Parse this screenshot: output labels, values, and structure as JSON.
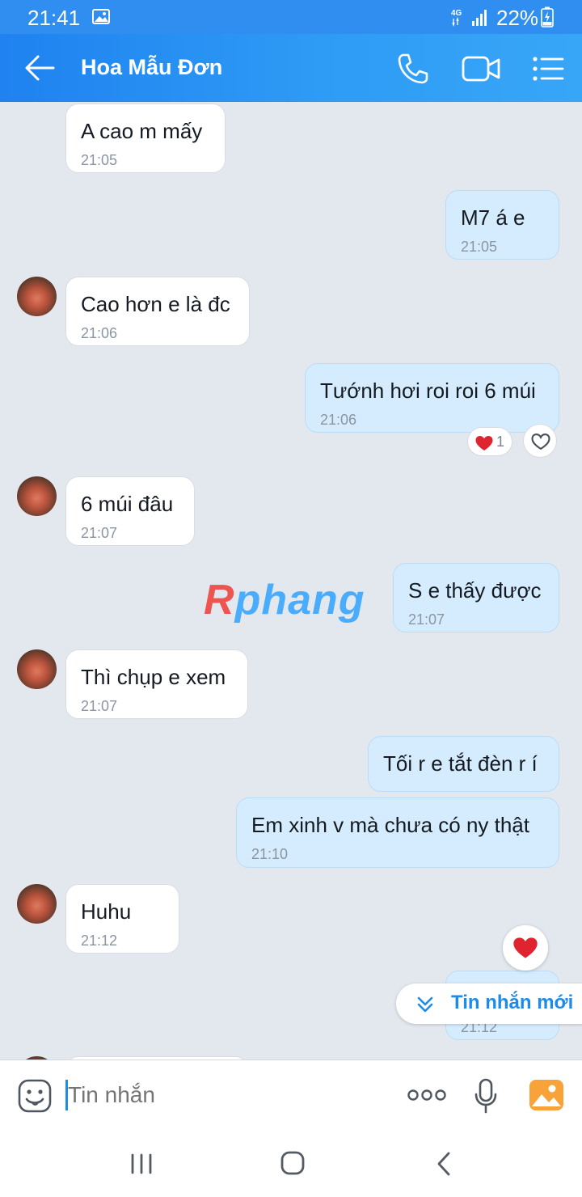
{
  "status_bar": {
    "time": "21:41",
    "network": "4G",
    "battery": "22%"
  },
  "header": {
    "title": "Hoa Mẫu Đơn"
  },
  "messages": [
    {
      "side": "in",
      "text": "A cao m mấy",
      "time": "21:05"
    },
    {
      "side": "out",
      "text": "M7 á e",
      "time": "21:05"
    },
    {
      "side": "in",
      "text": "Cao hơn e là đc",
      "time": "21:06"
    },
    {
      "side": "out",
      "text": "Tướnh hơi roi roi 6 múi",
      "time": "21:06",
      "reaction_count": "1"
    },
    {
      "side": "in",
      "text": "6 múi đâu",
      "time": "21:07"
    },
    {
      "side": "out",
      "text": "S e thấy được",
      "time": "21:07"
    },
    {
      "side": "in",
      "text": "Thì chụp e xem",
      "time": "21:07"
    },
    {
      "side": "out",
      "text": "Tối r e tắt đèn r í",
      "time": ""
    },
    {
      "side": "out",
      "text": "Em xinh v mà chưa có ny thật",
      "time": "21:10"
    },
    {
      "side": "in",
      "text": "Huhu",
      "time": "21:12"
    },
    {
      "side": "out",
      "text": "",
      "time": "21:12"
    }
  ],
  "watermark": {
    "first": "R",
    "rest": "phang"
  },
  "new_messages_label": "Tin nhắn mới",
  "input": {
    "placeholder": "Tin nhắn"
  },
  "colors": {
    "header": "#2e9bf5",
    "outgoing_bubble": "#d4ecfd",
    "incoming_bubble": "#ffffff",
    "background": "#e3e8ef",
    "accent": "#1d8bea"
  }
}
